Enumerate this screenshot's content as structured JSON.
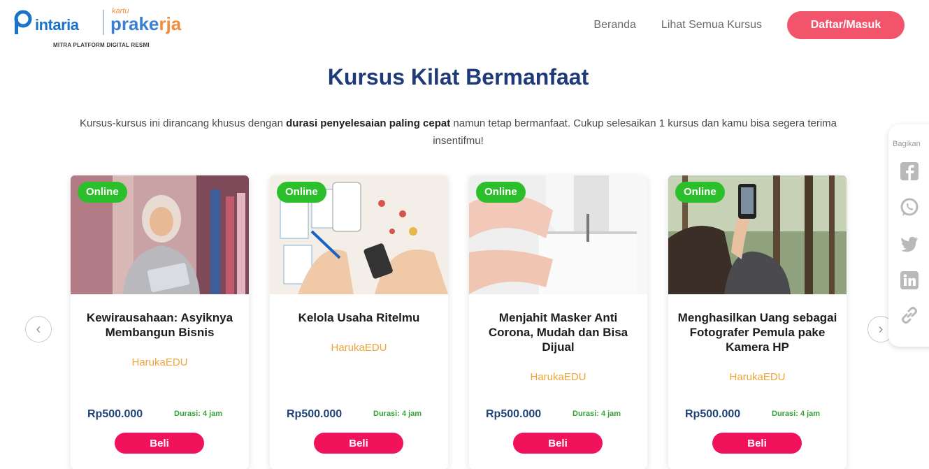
{
  "header": {
    "logo_pintaria": "intaria",
    "logo_kartu": "kartu",
    "logo_prakerja_main": "prake",
    "logo_prakerja_accent": "rja",
    "logo_tagline": "MITRA PLATFORM DIGITAL RESMI",
    "nav_home": "Beranda",
    "nav_courses": "Lihat Semua Kursus",
    "nav_login": "Daftar/Masuk"
  },
  "main": {
    "title": "Kursus Kilat Bermanfaat",
    "intro_part1": "Kursus-kursus ini dirancang khusus dengan ",
    "intro_bold": "durasi penyelesaian paling cepat",
    "intro_part2": " namun tetap bermanfaat. Cukup selesaikan 1 kursus dan kamu bisa segera terima insentifmu!"
  },
  "share": {
    "label": "Bagikan",
    "icons": [
      "facebook-icon",
      "whatsapp-icon",
      "twitter-icon",
      "linkedin-icon",
      "link-icon"
    ]
  },
  "carousel": {
    "prev_symbol": "‹",
    "next_symbol": "›"
  },
  "cards": [
    {
      "badge": "Online",
      "title": "Kewirausahaan: Asyiknya Membangun Bisnis",
      "provider": "HarukaEDU",
      "price": "Rp500.000",
      "duration": "Durasi: 4 jam",
      "buy": "Beli"
    },
    {
      "badge": "Online",
      "title": "Kelola Usaha Ritelmu",
      "provider": "HarukaEDU",
      "price": "Rp500.000",
      "duration": "Durasi: 4 jam",
      "buy": "Beli"
    },
    {
      "badge": "Online",
      "title": "Menjahit Masker Anti Corona, Mudah dan Bisa Dijual",
      "provider": "HarukaEDU",
      "price": "Rp500.000",
      "duration": "Durasi: 4 jam",
      "buy": "Beli"
    },
    {
      "badge": "Online",
      "title": "Menghasilkan Uang sebagai Fotografer Pemula pake Kamera HP",
      "provider": "HarukaEDU",
      "price": "Rp500.000",
      "duration": "Durasi: 4 jam",
      "buy": "Beli"
    }
  ],
  "colors": {
    "brand_blue": "#1f3a78",
    "cta_pink": "#f2546b",
    "buy_pink": "#f0125a",
    "online_green": "#2bc02b",
    "provider_orange": "#f0a43a"
  }
}
